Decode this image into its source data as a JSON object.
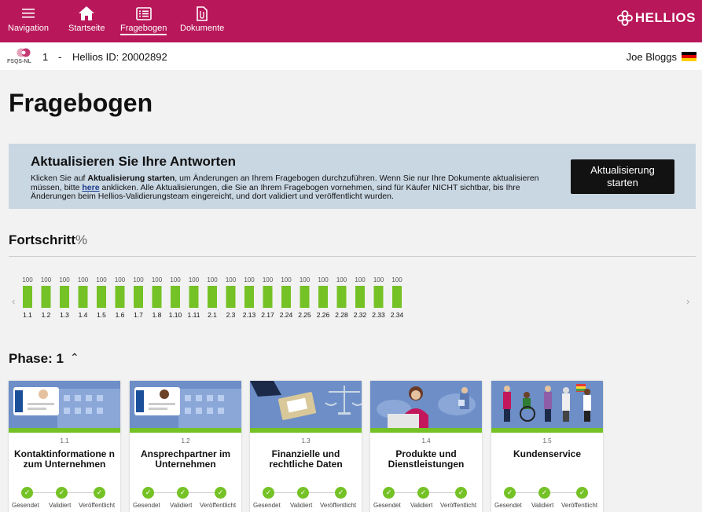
{
  "nav": {
    "items": [
      {
        "label": "Navigation",
        "icon": "hamburger-icon"
      },
      {
        "label": "Startseite",
        "icon": "home-icon"
      },
      {
        "label": "Fragebogen",
        "icon": "list-icon",
        "active": true
      },
      {
        "label": "Dokumente",
        "icon": "document-icon"
      }
    ],
    "brand": "HELLIOS"
  },
  "info": {
    "logo_label": "FSQS-NL",
    "number": "1",
    "separator": "-",
    "id_label": "Hellios ID:  20002892",
    "user": "Joe Bloggs",
    "flag": "german-flag-icon"
  },
  "page": {
    "title": "Fragebogen"
  },
  "banner": {
    "title": "Aktualisieren Sie Ihre Antworten",
    "text_1": "Klicken Sie auf ",
    "text_bold": "Aktualisierung starten",
    "text_2": ", um Änderungen an Ihrem Fragebogen durchzuführen. Wenn Sie nur Ihre Dokumente aktualisieren müssen, bitte ",
    "link": "here",
    "text_3": " anklicken. Alle Aktualisierungen, die Sie an Ihrem Fragebogen vornehmen, sind für Käufer NICHT sichtbar, bis Ihre Änderungen beim Hellios-Validierungsteam eingereicht, und dort validiert und veröffentlicht wurden.",
    "button_line1": "Aktualisierung",
    "button_line2": "starten"
  },
  "progress": {
    "title": "Fortschritt",
    "unit": "%",
    "prev_arrow": "‹",
    "next_arrow": "›"
  },
  "chart_data": {
    "type": "bar",
    "categories": [
      "1.1",
      "1.2",
      "1.3",
      "1.4",
      "1.5",
      "1.6",
      "1.7",
      "1.8",
      "1.10",
      "1.11",
      "2.1",
      "2.3",
      "2.13",
      "2.17",
      "2.24",
      "2.25",
      "2.26",
      "2.28",
      "2.32",
      "2.33",
      "2.34"
    ],
    "values": [
      100,
      100,
      100,
      100,
      100,
      100,
      100,
      100,
      100,
      100,
      100,
      100,
      100,
      100,
      100,
      100,
      100,
      100,
      100,
      100,
      100
    ],
    "ylim": [
      0,
      100
    ],
    "color": "#75c226",
    "grid": false
  },
  "phase": {
    "label": "Phase: 1",
    "chevron": "⌃"
  },
  "cards": [
    {
      "code": "1.1",
      "title": "Kontaktinformatione n zum Unternehmen",
      "steps": [
        "Gesendet",
        "Validiert",
        "Veröffentlicht"
      ]
    },
    {
      "code": "1.2",
      "title": "Ansprechpartner im Unternehmen",
      "steps": [
        "Gesendet",
        "Validiert",
        "Veröffentlicht"
      ]
    },
    {
      "code": "1.3",
      "title": "Finanzielle und rechtliche Daten",
      "steps": [
        "Gesendet",
        "Validiert",
        "Veröffentlicht"
      ]
    },
    {
      "code": "1.4",
      "title": "Produkte und Dienstleistungen",
      "steps": [
        "Gesendet",
        "Validiert",
        "Veröffentlicht"
      ]
    },
    {
      "code": "1.5",
      "title": "Kundenservice",
      "steps": [
        "Gesendet",
        "Validiert",
        "Veröffentlicht"
      ]
    }
  ],
  "colors": {
    "brand": "#b8175a",
    "accent_green": "#75c226",
    "banner_bg": "#c9d7e3"
  }
}
